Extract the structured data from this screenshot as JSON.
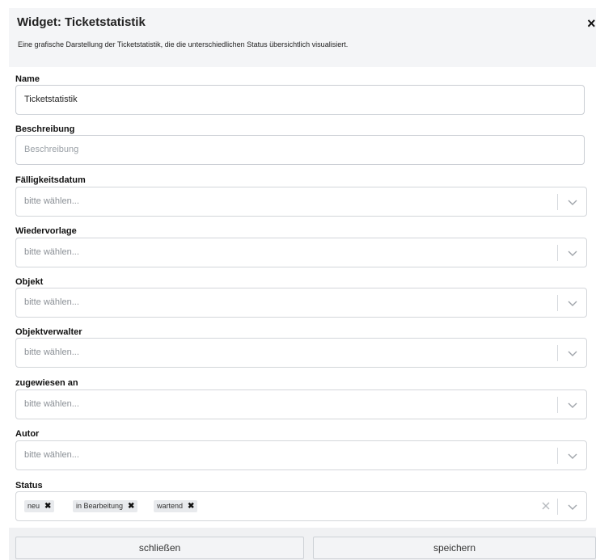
{
  "header": {
    "title": "Widget: Ticketstatistik",
    "description": "Eine grafische Darstellung der Ticketstatistik, die die unterschiedlichen Status übersichtlich visualisiert.",
    "close_icon": "×"
  },
  "fields": {
    "name": {
      "label": "Name",
      "value": "Ticketstatistik"
    },
    "beschreibung": {
      "label": "Beschreibung",
      "placeholder": "Beschreibung"
    },
    "faelligkeitsdatum": {
      "label": "Fälligkeitsdatum",
      "placeholder": "bitte wählen..."
    },
    "wiedervorlage": {
      "label": "Wiedervorlage",
      "placeholder": "bitte wählen..."
    },
    "objekt": {
      "label": "Objekt",
      "placeholder": "bitte wählen..."
    },
    "objektverwalter": {
      "label": "Objektverwalter",
      "placeholder": "bitte wählen..."
    },
    "zugewiesen_an": {
      "label": "zugewiesen an",
      "placeholder": "bitte wählen..."
    },
    "autor": {
      "label": "Autor",
      "placeholder": "bitte wählen..."
    },
    "status": {
      "label": "Status",
      "tags": [
        "neu",
        "in Bearbeitung",
        "wartend"
      ],
      "tag_remove": "✖"
    }
  },
  "footer": {
    "close_label": "schließen",
    "save_label": "speichern"
  },
  "colors": {
    "header_bg": "#f4f5f7",
    "border": "#c9cdd3",
    "tag_bg": "#e8eaed"
  }
}
